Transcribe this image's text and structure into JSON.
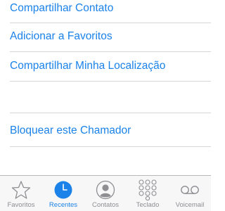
{
  "actions": [
    {
      "label": "Compartilhar Contato"
    },
    {
      "label": "Adicionar a Favoritos"
    },
    {
      "label": "Compartilhar Minha Localização"
    },
    {
      "label": "Bloquear este Chamador"
    }
  ],
  "tabbar": {
    "tabs": [
      {
        "label": "Favoritos",
        "icon": "star-icon"
      },
      {
        "label": "Recentes",
        "icon": "clock-icon",
        "active": true
      },
      {
        "label": "Contatos",
        "icon": "contacts-icon"
      },
      {
        "label": "Teclado",
        "icon": "keypad-icon"
      },
      {
        "label": "Voicemail",
        "icon": "voicemail-icon"
      }
    ]
  },
  "colors": {
    "accent": "#1a82e8",
    "inactive": "#8e8e93",
    "separator": "#d6d6d8",
    "tabbar_bg": "#f7f7f7"
  }
}
